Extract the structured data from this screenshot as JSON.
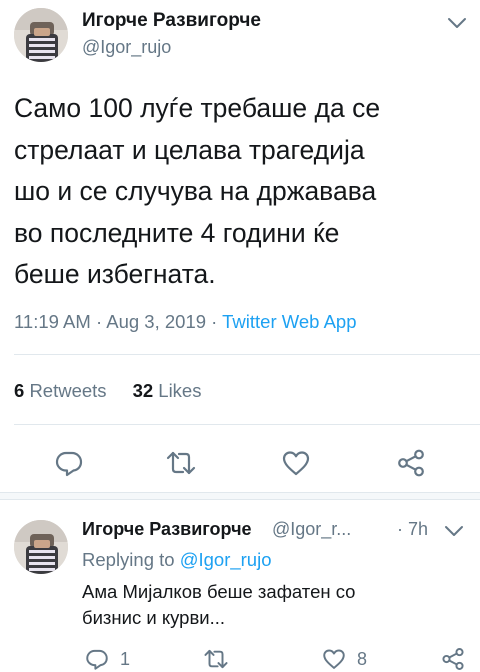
{
  "main_tweet": {
    "display_name": "Игорче Развигорче",
    "handle": "@Igor_rujo",
    "text": "Само 100 луѓе требаше да се\nстрелаат и целава трагедија\nшо и се случува на државава\nво последните 4 години ќе\nбеше избегната.",
    "time": "11:19 AM",
    "date": "Aug 3, 2019",
    "dot": "·",
    "source": "Twitter Web App",
    "retweets_count": "6",
    "retweets_label": "Retweets",
    "likes_count": "32",
    "likes_label": "Likes"
  },
  "reply_tweet": {
    "display_name": "Игорче Развигорче",
    "handle": "@Igor_r...",
    "dot": "·",
    "time": "7h",
    "replying_label": "Replying to",
    "replying_mention": "@Igor_rujo",
    "text": "Ама Мијалков беше зафатен со\nбизнис и курви...",
    "reply_count": "1",
    "like_count": "8"
  },
  "icons": {
    "reply": "reply-icon",
    "retweet": "retweet-icon",
    "like": "heart-icon",
    "share": "share-icon",
    "more": "chevron-down-icon"
  },
  "colors": {
    "link": "#1da1f2",
    "secondary_text": "#657786",
    "primary_text": "#14171a",
    "divider": "#e1e8ed"
  }
}
